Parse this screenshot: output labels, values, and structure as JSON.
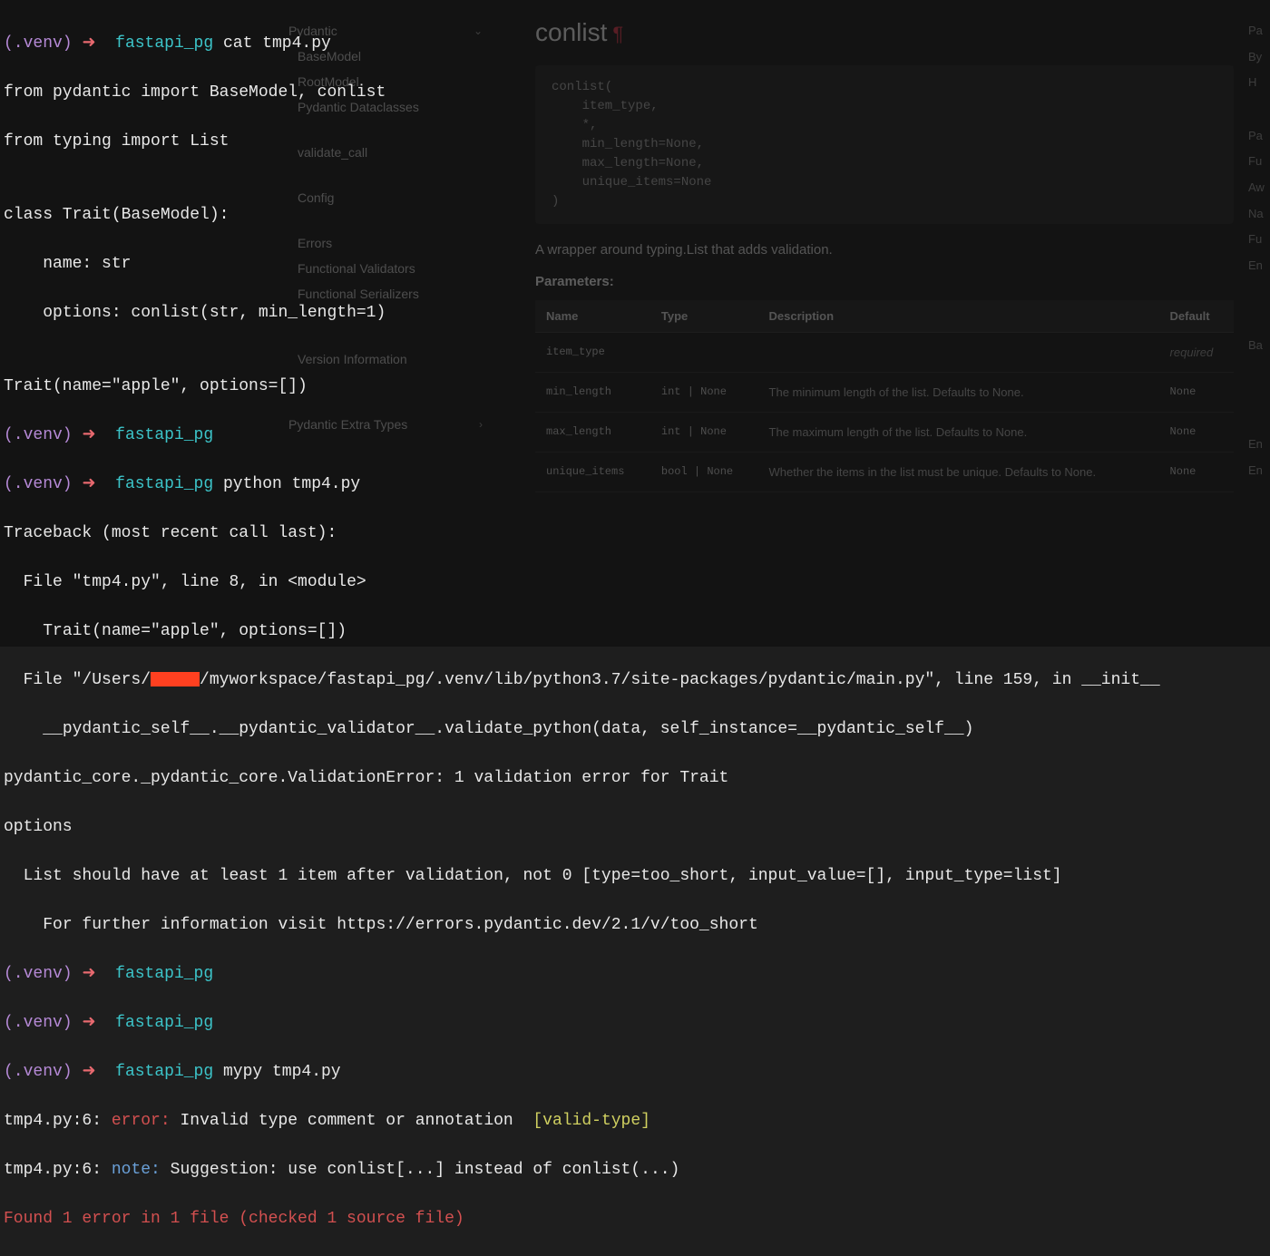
{
  "docs": {
    "sidebar": {
      "top": "Pydantic",
      "items": [
        "BaseModel",
        "RootModel",
        "Pydantic Dataclasses",
        "validate_call",
        "Config",
        "Errors",
        "Functional Validators",
        "Functional Serializers",
        "Version Information",
        "Pydantic Extra Types"
      ]
    },
    "main": {
      "title": "conlist",
      "signature": "conlist(\n    item_type,\n    *,\n    min_length=None,\n    max_length=None,\n    unique_items=None\n)",
      "description": "A wrapper around typing.List that adds validation.",
      "params_heading": "Parameters:",
      "table": {
        "headers": [
          "Name",
          "Type",
          "Description",
          "Default"
        ],
        "rows": [
          {
            "name": "item_type",
            "type": "",
            "desc": "",
            "default": "required"
          },
          {
            "name": "min_length",
            "type": "int | None",
            "desc": "The minimum length of the list. Defaults to None.",
            "default": "None"
          },
          {
            "name": "max_length",
            "type": "int | None",
            "desc": "The maximum length of the list. Defaults to None.",
            "default": "None"
          },
          {
            "name": "unique_items",
            "type": "bool | None",
            "desc": "Whether the items in the list must be unique. Defaults to None.",
            "default": "None"
          }
        ]
      }
    },
    "right": [
      "Pa",
      "By",
      "H",
      "Pa",
      "Fu",
      "Aw",
      "Na",
      "Fu",
      "En",
      "Ba",
      "En",
      "En"
    ]
  },
  "terminal": {
    "prompt": {
      "venv": "(.venv)",
      "arrow": "➜",
      "dir": "fastapi_pg"
    },
    "cmd_cat": "cat tmp4.py",
    "file_content": [
      "from pydantic import BaseModel, conlist",
      "from typing import List",
      "",
      "class Trait(BaseModel):",
      "    name: str",
      "    options: conlist(str, min_length=1)",
      "",
      "Trait(name=\"apple\", options=[])"
    ],
    "cmd_python": "python tmp4.py",
    "traceback": {
      "header": "Traceback (most recent call last):",
      "frame1": "  File \"tmp4.py\", line 8, in <module>",
      "frame1_code": "    Trait(name=\"apple\", options=[])",
      "frame2a": "  File \"/Users/",
      "frame2b": "/myworkspace/fastapi_pg/.venv/lib/python3.7/site-packages/pydantic/main.py\", line 159, in __init__",
      "frame2_code": "    __pydantic_self__.__pydantic_validator__.validate_python(data, self_instance=__pydantic_self__)",
      "error_type": "pydantic_core._pydantic_core.ValidationError: 1 validation error for Trait",
      "error_field": "options",
      "error_msg": "  List should have at least 1 item after validation, not 0 [type=too_short, input_value=[], input_type=list]",
      "error_link": "    For further information visit https://errors.pydantic.dev/2.1/v/too_short"
    },
    "cmd_mypy": "mypy tmp4.py",
    "mypy": {
      "loc": "tmp4.py:6:",
      "error_label": "error:",
      "error_msg": "Invalid type comment or annotation  ",
      "error_code": "[valid-type]",
      "note_label": "note:",
      "note_msg": "Suggestion: use conlist[...] instead of conlist(...)",
      "summary": "Found 1 error in 1 file (checked 1 source file)"
    }
  }
}
